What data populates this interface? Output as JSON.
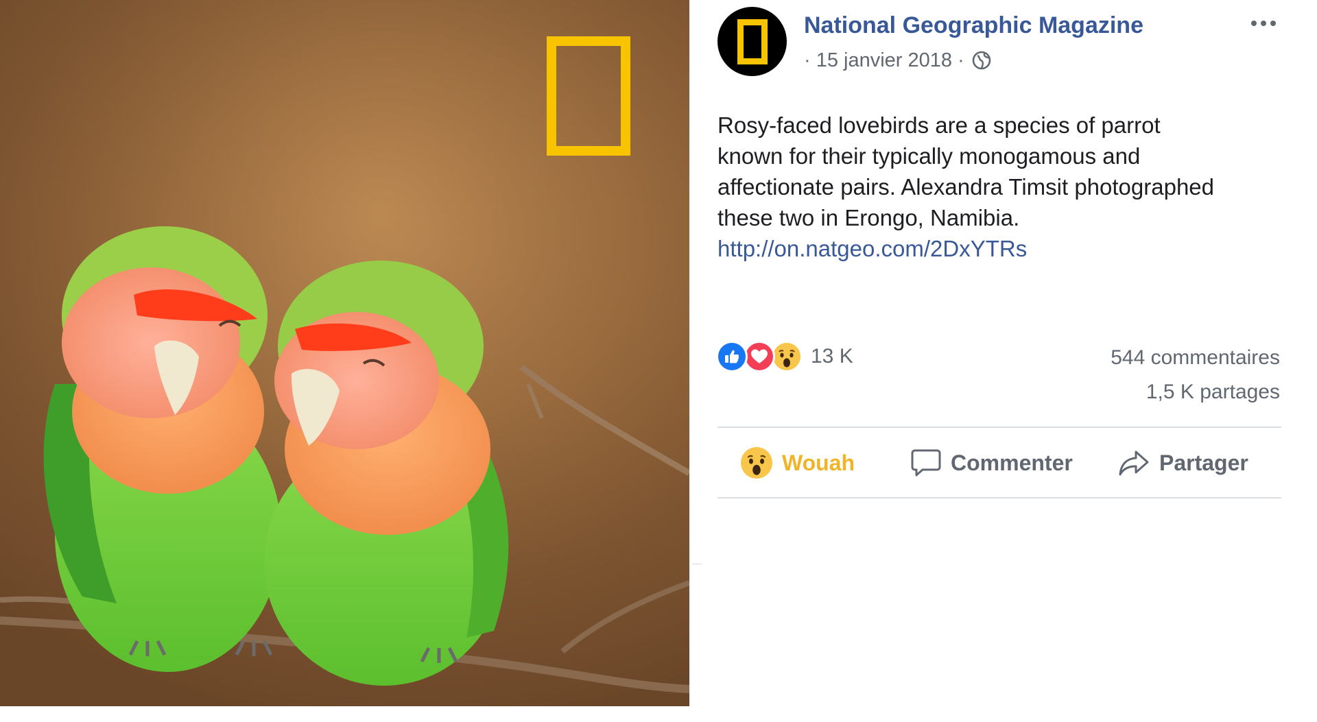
{
  "post": {
    "page_name": "National Geographic Magazine",
    "date": "· 15 janvier 2018 ·",
    "privacy_icon": "globe-icon",
    "text_lines": [
      "Rosy-faced lovebirds are a species of parrot",
      "known for their typically monogamous and",
      "affectionate pairs. Alexandra Timsit photographed",
      "these two in Erongo, Namibia."
    ],
    "link": "http://on.natgeo.com/2DxYTRs"
  },
  "stats": {
    "reaction_icons": [
      "like-icon",
      "love-icon",
      "wow-icon"
    ],
    "reactions": "13 K",
    "comments": "544 commentaires",
    "shares": "1,5 K partages"
  },
  "actions": {
    "wow": "Wouah",
    "comment": "Commenter",
    "share": "Partager"
  },
  "colors": {
    "brand_yellow": "#f8c400",
    "link_blue": "#385898",
    "like_blue": "#1877f2",
    "love_red": "#f33e58",
    "wow_yellow": "#f7c64a",
    "wow_label": "#f0b429",
    "secondary_text": "#606770"
  }
}
